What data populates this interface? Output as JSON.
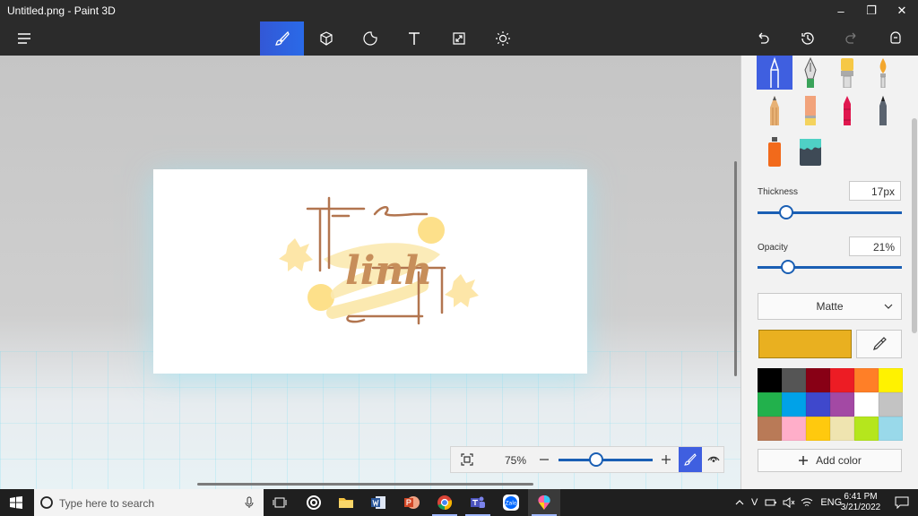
{
  "window": {
    "title": "Untitled.png - Paint 3D"
  },
  "toolbar": {
    "tools": [
      "brushes-icon",
      "3d-shapes-icon",
      "stickers-icon",
      "text-icon",
      "canvas-icon",
      "effects-icon"
    ],
    "active_tool": "brushes-icon"
  },
  "canvas": {
    "drawing_text": "linh"
  },
  "zoom": {
    "value": "75%",
    "level": 0.4
  },
  "panel": {
    "thickness_label": "Thickness",
    "thickness_value": "17px",
    "thickness_level": 0.2,
    "opacity_label": "Opacity",
    "opacity_value": "21%",
    "opacity_level": 0.21,
    "finish": "Matte",
    "current_color": "#e9b020",
    "palette": [
      "#000000",
      "#555555",
      "#880015",
      "#ed1c24",
      "#ff7f27",
      "#fff200",
      "#22b14c",
      "#00a2e8",
      "#3f48cc",
      "#a349a4",
      "#ffffff",
      "#c3c3c3",
      "#b97a57",
      "#ffaec9",
      "#ffc90e",
      "#efe4b0",
      "#b5e61d",
      "#99d9ea"
    ],
    "add_color_label": "Add color"
  },
  "taskbar": {
    "search_placeholder": "Type here to search",
    "language": "ENG",
    "time": "6:41 PM",
    "date": "3/21/2022",
    "tray_v": "V"
  }
}
